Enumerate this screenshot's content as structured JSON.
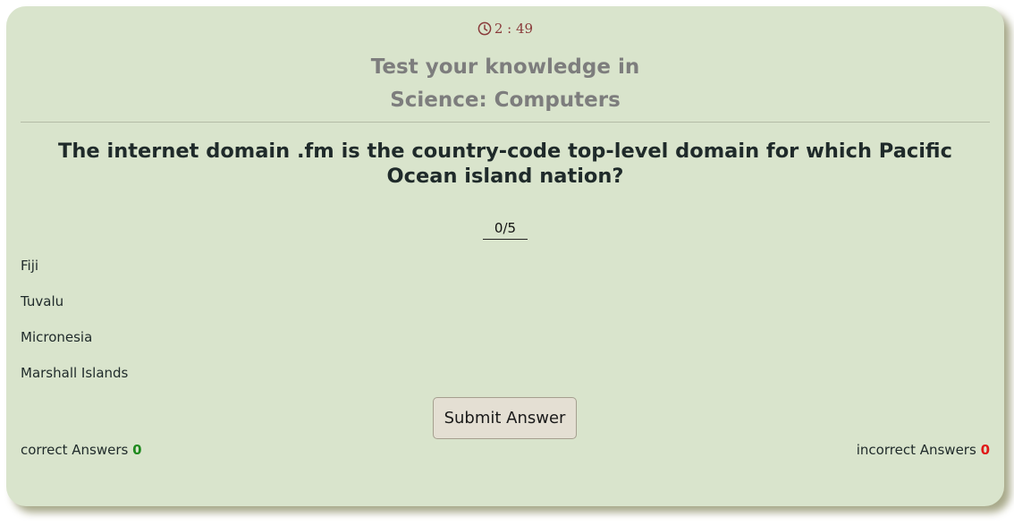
{
  "timer": {
    "icon": "clock-icon",
    "text": "2 : 49",
    "color": "#8a3b3b"
  },
  "heading": {
    "line1": "Test your knowledge in",
    "line2": "Science: Computers"
  },
  "question": {
    "text": "The internet domain .fm is the country-code top-level domain for which Pacific Ocean island nation?"
  },
  "progress": {
    "text": "0/5"
  },
  "options": [
    {
      "label": "Fiji"
    },
    {
      "label": "Tuvalu"
    },
    {
      "label": "Micronesia"
    },
    {
      "label": "Marshall Islands"
    }
  ],
  "submit": {
    "label": "Submit Answer"
  },
  "score": {
    "correct_label": "correct Answers",
    "correct_count": "0",
    "incorrect_label": "incorrect Answers",
    "incorrect_count": "0",
    "correct_color": "#1f8a1f",
    "incorrect_color": "#e01818"
  },
  "colors": {
    "card_background": "#d9e4cc",
    "card_shadow": "#a8a98a",
    "button_background": "#e4dfd3"
  }
}
